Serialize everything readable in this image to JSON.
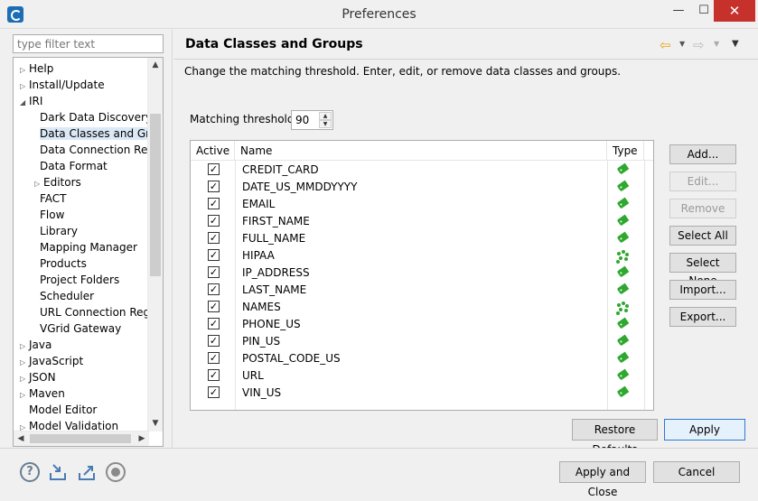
{
  "window": {
    "title": "Preferences"
  },
  "filter": {
    "placeholder": "type filter text"
  },
  "tree": {
    "items": [
      {
        "label": "Help",
        "level": 0,
        "expander": "closed"
      },
      {
        "label": "Install/Update",
        "level": 0,
        "expander": "closed"
      },
      {
        "label": "IRI",
        "level": 0,
        "expander": "open"
      },
      {
        "label": "Dark Data Discovery",
        "level": 1,
        "expander": "none"
      },
      {
        "label": "Data Classes and Grou",
        "level": 1,
        "expander": "none",
        "selected": true
      },
      {
        "label": "Data Connection Regi",
        "level": 1,
        "expander": "none"
      },
      {
        "label": "Data Format",
        "level": 1,
        "expander": "none"
      },
      {
        "label": "Editors",
        "level": 1,
        "expander": "closed"
      },
      {
        "label": "FACT",
        "level": 1,
        "expander": "none"
      },
      {
        "label": "Flow",
        "level": 1,
        "expander": "none"
      },
      {
        "label": "Library",
        "level": 1,
        "expander": "none"
      },
      {
        "label": "Mapping Manager",
        "level": 1,
        "expander": "none"
      },
      {
        "label": "Products",
        "level": 1,
        "expander": "none"
      },
      {
        "label": "Project Folders",
        "level": 1,
        "expander": "none"
      },
      {
        "label": "Scheduler",
        "level": 1,
        "expander": "none"
      },
      {
        "label": "URL Connection Regi",
        "level": 1,
        "expander": "none"
      },
      {
        "label": "VGrid Gateway",
        "level": 1,
        "expander": "none"
      },
      {
        "label": "Java",
        "level": 0,
        "expander": "closed"
      },
      {
        "label": "JavaScript",
        "level": 0,
        "expander": "closed"
      },
      {
        "label": "JSON",
        "level": 0,
        "expander": "closed"
      },
      {
        "label": "Maven",
        "level": 0,
        "expander": "closed"
      },
      {
        "label": "Model Editor",
        "level": 0,
        "expander": "none"
      },
      {
        "label": "Model Validation",
        "level": 0,
        "expander": "closed"
      }
    ]
  },
  "page": {
    "title": "Data Classes and Groups",
    "description": "Change the matching threshold. Enter, edit, or remove data classes and groups.",
    "threshold_label": "Matching threshold:",
    "threshold_value": "90",
    "columns": {
      "active": "Active",
      "name": "Name",
      "type": "Type"
    },
    "rows": [
      {
        "name": "CREDIT_CARD",
        "active": true,
        "type_icon": "data-class-icon"
      },
      {
        "name": "DATE_US_MMDDYYYY",
        "active": true,
        "type_icon": "data-class-icon"
      },
      {
        "name": "EMAIL",
        "active": true,
        "type_icon": "data-class-icon"
      },
      {
        "name": "FIRST_NAME",
        "active": true,
        "type_icon": "data-class-icon"
      },
      {
        "name": "FULL_NAME",
        "active": true,
        "type_icon": "data-class-icon"
      },
      {
        "name": "HIPAA",
        "active": true,
        "type_icon": "data-group-icon"
      },
      {
        "name": "IP_ADDRESS",
        "active": true,
        "type_icon": "data-class-icon"
      },
      {
        "name": "LAST_NAME",
        "active": true,
        "type_icon": "data-class-icon"
      },
      {
        "name": "NAMES",
        "active": true,
        "type_icon": "data-group-icon"
      },
      {
        "name": "PHONE_US",
        "active": true,
        "type_icon": "data-class-icon"
      },
      {
        "name": "PIN_US",
        "active": true,
        "type_icon": "data-class-icon"
      },
      {
        "name": "POSTAL_CODE_US",
        "active": true,
        "type_icon": "data-class-icon"
      },
      {
        "name": "URL",
        "active": true,
        "type_icon": "data-class-icon"
      },
      {
        "name": "VIN_US",
        "active": true,
        "type_icon": "data-class-icon"
      }
    ],
    "buttons": {
      "add": "Add...",
      "edit": "Edit...",
      "remove": "Remove",
      "select_all": "Select All",
      "select_none": "Select None",
      "import": "Import...",
      "export": "Export..."
    },
    "restore_defaults": "Restore Defaults",
    "apply": "Apply"
  },
  "footer": {
    "apply_and_close": "Apply and Close",
    "cancel": "Cancel"
  },
  "colors": {
    "tag_green": "#2fa82f",
    "selection": "#dbe8f6",
    "accent": "#2d7ad6"
  }
}
